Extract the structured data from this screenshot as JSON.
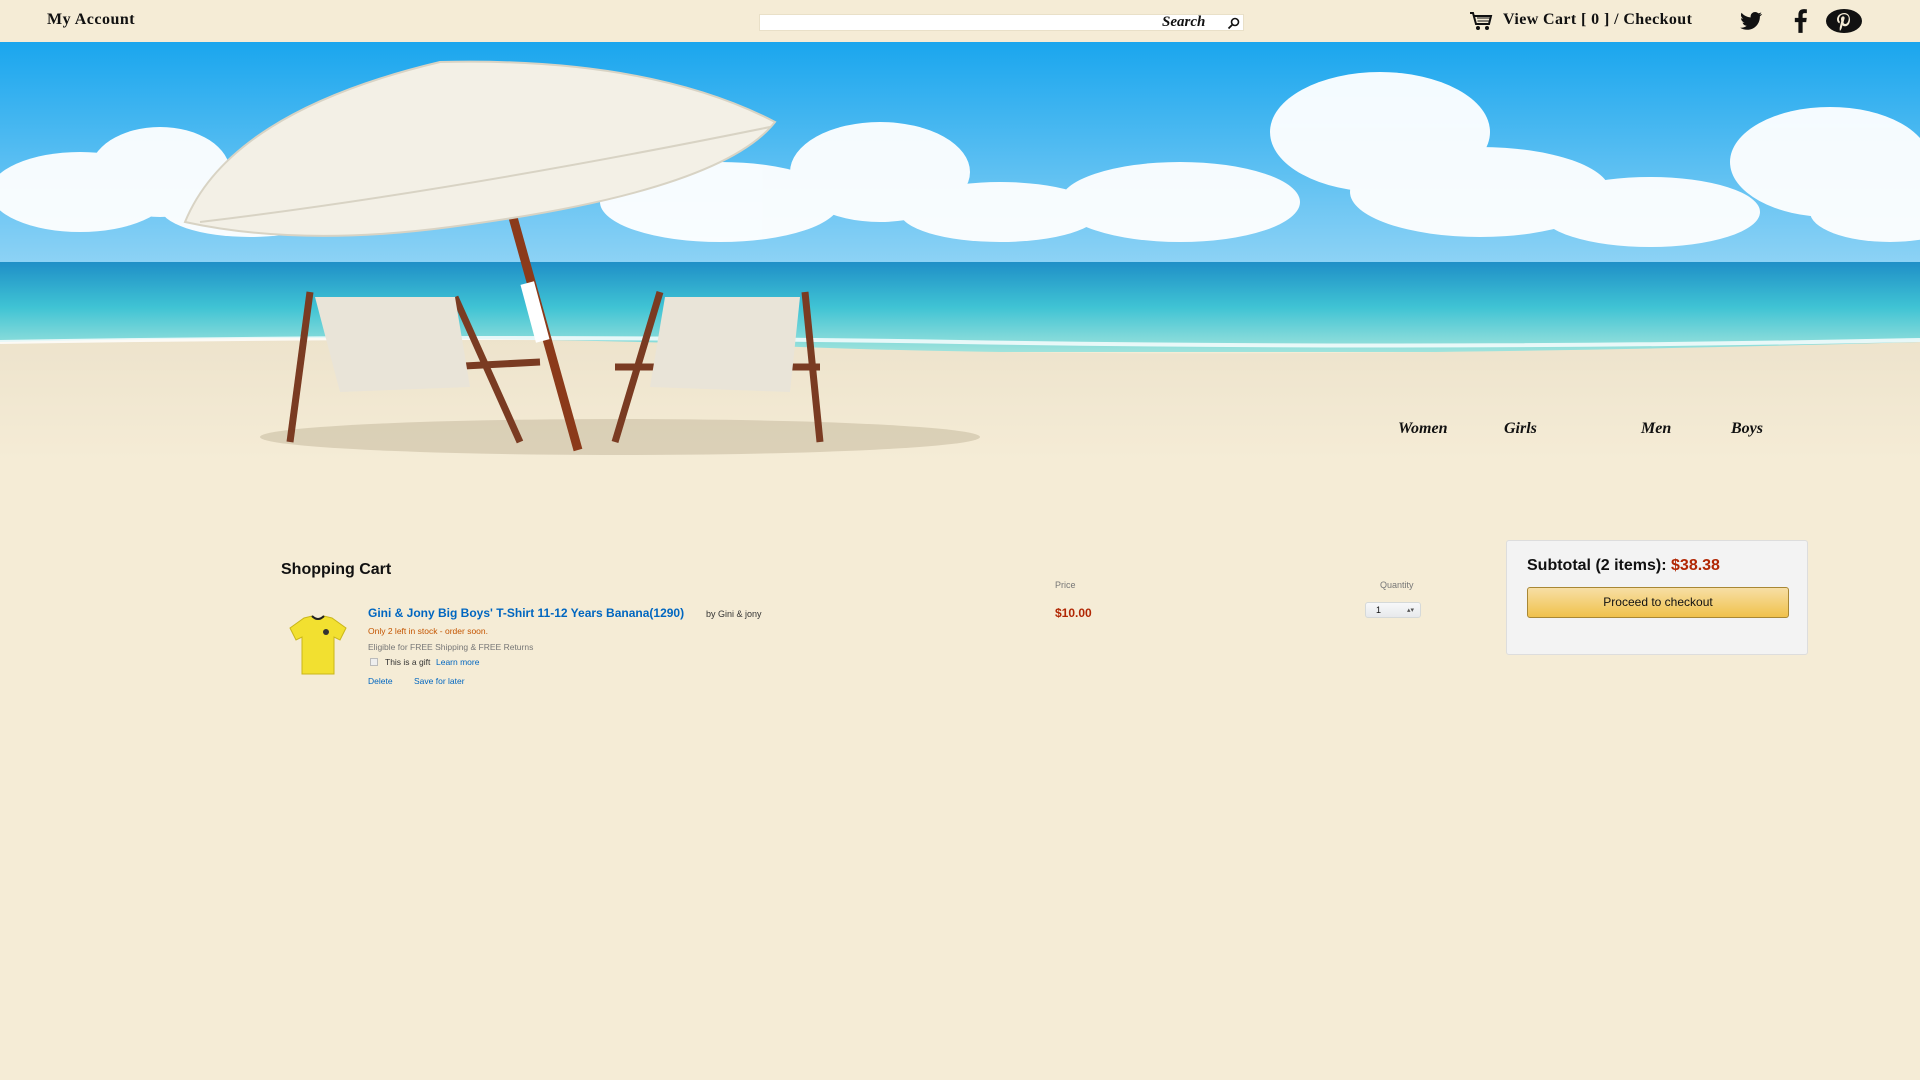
{
  "topbar": {
    "my_account": "My Account",
    "search_label": "Search",
    "cart_link": "View Cart [ 0 ] / Checkout",
    "social": [
      "twitter-icon",
      "facebook-icon",
      "pinterest-icon"
    ]
  },
  "nav": {
    "categories": [
      "Women",
      "Girls",
      "Men",
      "Boys"
    ]
  },
  "cart": {
    "title": "Shopping Cart",
    "price_header": "Price",
    "quantity_header": "Quantity",
    "item": {
      "title": "Gini & Jony Big Boys' T-Shirt 11-12 Years Banana(1290)",
      "by": "by Gini & jony",
      "stock": "Only 2 left in stock - order soon.",
      "eligible": "Eligible for FREE Shipping & FREE Returns",
      "gift": "This is a gift",
      "learn_more": "Learn more",
      "delete": "Delete",
      "save_for_later": "Save for later",
      "price": "$10.00",
      "quantity": "1"
    }
  },
  "subtotal": {
    "label": "Subtotal (2 items):",
    "amount": "$38.38",
    "checkout_button": "Proceed to checkout"
  },
  "colors": {
    "background": "#f5ecd6",
    "price_red": "#b12704",
    "link_blue": "#0066c0",
    "button_yellow": "#f0c14b"
  }
}
